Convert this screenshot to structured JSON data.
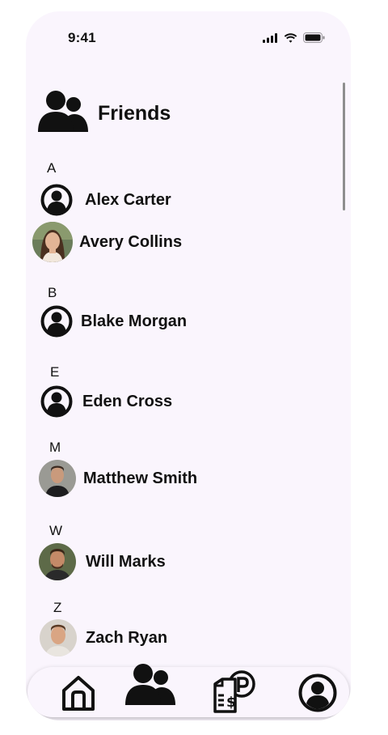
{
  "status_bar": {
    "time": "9:41"
  },
  "header": {
    "title": "Friends",
    "icon": "people-icon"
  },
  "sections": [
    {
      "letter": "A",
      "friends": [
        {
          "name": "Alex Carter",
          "avatar": "default-avatar-icon"
        },
        {
          "name": "Avery Collins",
          "avatar": "photo"
        }
      ]
    },
    {
      "letter": "B",
      "friends": [
        {
          "name": "Blake Morgan",
          "avatar": "default-avatar-icon"
        }
      ]
    },
    {
      "letter": "E",
      "friends": [
        {
          "name": "Eden Cross",
          "avatar": "default-avatar-icon"
        }
      ]
    },
    {
      "letter": "M",
      "friends": [
        {
          "name": "Matthew Smith",
          "avatar": "photo"
        }
      ]
    },
    {
      "letter": "W",
      "friends": [
        {
          "name": "Will Marks",
          "avatar": "photo"
        }
      ]
    },
    {
      "letter": "Z",
      "friends": [
        {
          "name": "Zach Ryan",
          "avatar": "photo"
        }
      ]
    }
  ],
  "bottom_nav": {
    "items": [
      "home-icon",
      "friends-icon",
      "payment-icon",
      "profile-icon"
    ],
    "active": "friends-icon"
  }
}
